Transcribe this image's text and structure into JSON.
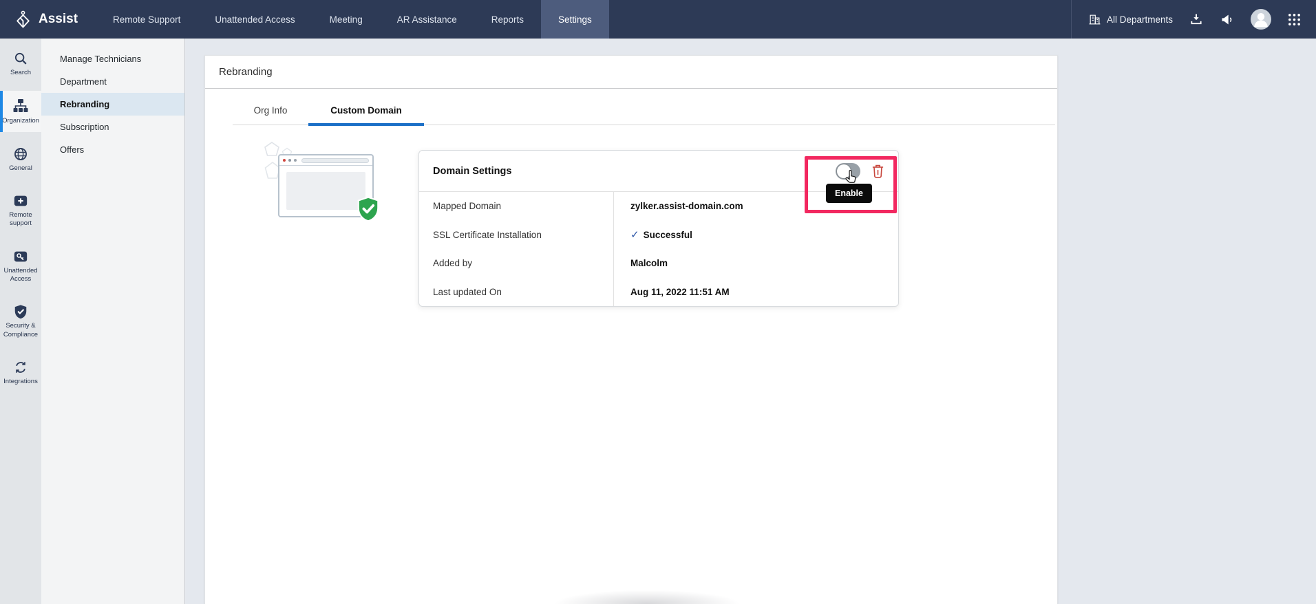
{
  "brand": {
    "name": "Assist"
  },
  "nav": {
    "items": [
      "Remote Support",
      "Unattended Access",
      "Meeting",
      "AR Assistance",
      "Reports",
      "Settings"
    ],
    "active": "Settings",
    "department": "All Departments"
  },
  "sidebar": {
    "items": [
      {
        "label": "Search",
        "icon": "search-icon"
      },
      {
        "label": "Organization",
        "icon": "organization-icon"
      },
      {
        "label": "General",
        "icon": "globe-icon"
      },
      {
        "label": "Remote support",
        "icon": "remote-support-icon"
      },
      {
        "label": "Unattended Access",
        "icon": "unattended-access-icon"
      },
      {
        "label": "Security & Compliance",
        "icon": "security-shield-icon"
      },
      {
        "label": "Integrations",
        "icon": "integrations-icon"
      }
    ],
    "active": "Organization"
  },
  "submenu": {
    "items": [
      "Manage Technicians",
      "Department",
      "Rebranding",
      "Subscription",
      "Offers"
    ],
    "active": "Rebranding"
  },
  "page": {
    "title": "Rebranding",
    "tabs": [
      "Org Info",
      "Custom Domain"
    ],
    "active_tab": "Custom Domain"
  },
  "card": {
    "title": "Domain Settings",
    "tooltip": "Enable",
    "rows": [
      {
        "label": "Mapped Domain",
        "value": "zylker.assist-domain.com"
      },
      {
        "label": "SSL Certificate Installation",
        "value": "Successful",
        "status": "success"
      },
      {
        "label": "Added by",
        "value": "Malcolm"
      },
      {
        "label": "Last updated On",
        "value": "Aug 11, 2022 11:51 AM"
      }
    ]
  },
  "colors": {
    "navbar": "#2d3a56",
    "nav_active": "#4d5c7d",
    "accent_blue": "#1b6fc7",
    "sidebar_active_bar": "#1e88e5",
    "submenu_selected": "#dbe7f1",
    "highlight_pink": "#f22860",
    "trash_red": "#c8473d",
    "success_check": "#2b55a7",
    "shield_green": "#2da44e",
    "tooltip_bg": "#0b0b0b"
  }
}
